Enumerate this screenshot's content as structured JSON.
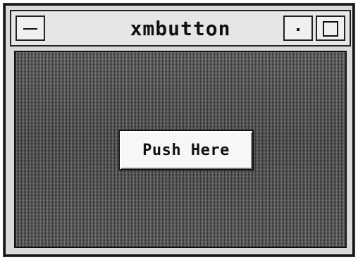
{
  "window": {
    "title": "xmbutton"
  },
  "button": {
    "label": "Push Here"
  },
  "icons": {
    "menu": "window-menu-icon",
    "iconify": "iconify-icon",
    "maximize": "maximize-icon"
  },
  "colors": {
    "frame": "#d9d9d9",
    "title_bar": "#e6e6e6",
    "client_background": "#4f4f4f",
    "button_face": "#f7f7f7",
    "text": "#111111"
  }
}
